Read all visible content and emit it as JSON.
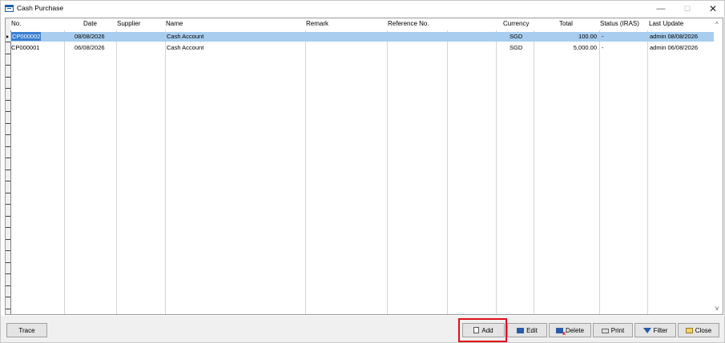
{
  "window": {
    "title": "Cash Purchase",
    "controls": {
      "minimize": "—",
      "maximize": "☐",
      "close": "✕"
    }
  },
  "grid": {
    "columns": [
      "No.",
      "Date",
      "Supplier",
      "Name",
      "Remark",
      "Reference No.",
      "",
      "Currency",
      "Total",
      "Status (IRAS)",
      "Last Update"
    ],
    "rows": [
      {
        "no": "CP000002",
        "date": "08/08/2026",
        "supplier": "",
        "name": "Cash Account",
        "remark": "",
        "ref": "",
        "blank": "",
        "currency": "SGD",
        "total": "100.00",
        "status": "-",
        "last_update": "admin 08/08/2026",
        "selected": true
      },
      {
        "no": "CP000001",
        "date": "06/08/2026",
        "supplier": "",
        "name": "Cash Account",
        "remark": "",
        "ref": "",
        "blank": "",
        "currency": "SGD",
        "total": "5,000.00",
        "status": "-",
        "last_update": "admin 06/08/2026",
        "selected": false
      }
    ],
    "scroll_up": "^",
    "scroll_down": "v"
  },
  "buttons": {
    "trace": "Trace",
    "add": "Add",
    "edit": "Edit",
    "delete": "Delete",
    "print": "Print",
    "filter": "Filter",
    "close": "Close"
  },
  "colors": {
    "selected_row": "#a8cdee",
    "selected_cell": "#3a7fd0",
    "highlight_box": "#e0101a"
  },
  "icons": [
    "table-icon",
    "add-icon",
    "edit-icon",
    "delete-icon",
    "print-icon",
    "filter-icon",
    "close-folder-icon"
  ]
}
